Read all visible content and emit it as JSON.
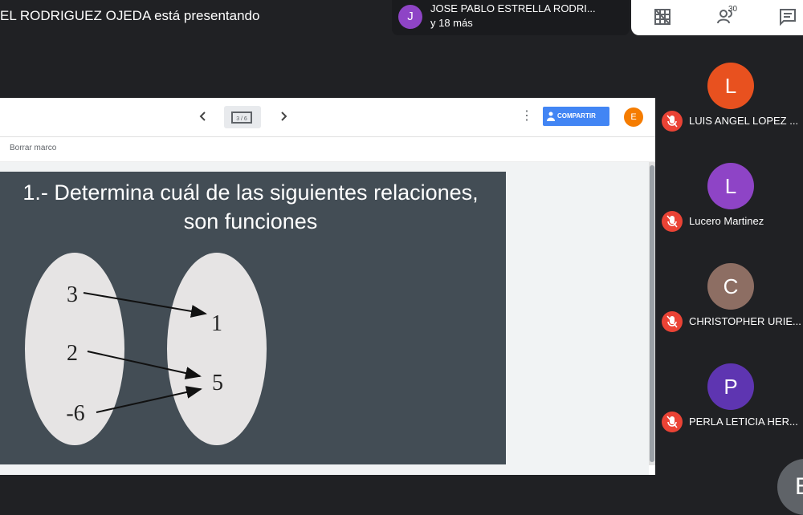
{
  "meet": {
    "presenting_text": "EL RODRIGUEZ OJEDA está presentando",
    "participants_chip": {
      "avatar_letter": "J",
      "name": "JOSE PABLO ESTRELLA RODRI...",
      "more": "y 18 más"
    },
    "toolbar": {
      "people_count": "30"
    },
    "participants": [
      {
        "letter": "L",
        "name": "LUIS ANGEL LOPEZ ...",
        "color": "#e8511f"
      },
      {
        "letter": "L",
        "name": "Lucero Martinez",
        "color": "#8e44c6"
      },
      {
        "letter": "C",
        "name": "CHRISTOPHER URIE...",
        "color": "#8d6e63"
      },
      {
        "letter": "P",
        "name": "PERLA LETICIA HER...",
        "color": "#5e35b1"
      }
    ],
    "bottom_avatar_letter": "E"
  },
  "slides": {
    "thumb_label": "3 / 6",
    "share_label": "COMPARTIR",
    "user_letter": "E",
    "clear_frame": "Borrar marco",
    "slide": {
      "title_line1": "1.- Determina cuál de las siguientes relaciones,",
      "title_line2": "son funciones",
      "domain": [
        "3",
        "2",
        "-6"
      ],
      "codomain": [
        "1",
        "5"
      ]
    }
  },
  "colors": {
    "slide_bg": "#434d55",
    "share_blue": "#4285f4",
    "mic_red": "#ea4335"
  }
}
